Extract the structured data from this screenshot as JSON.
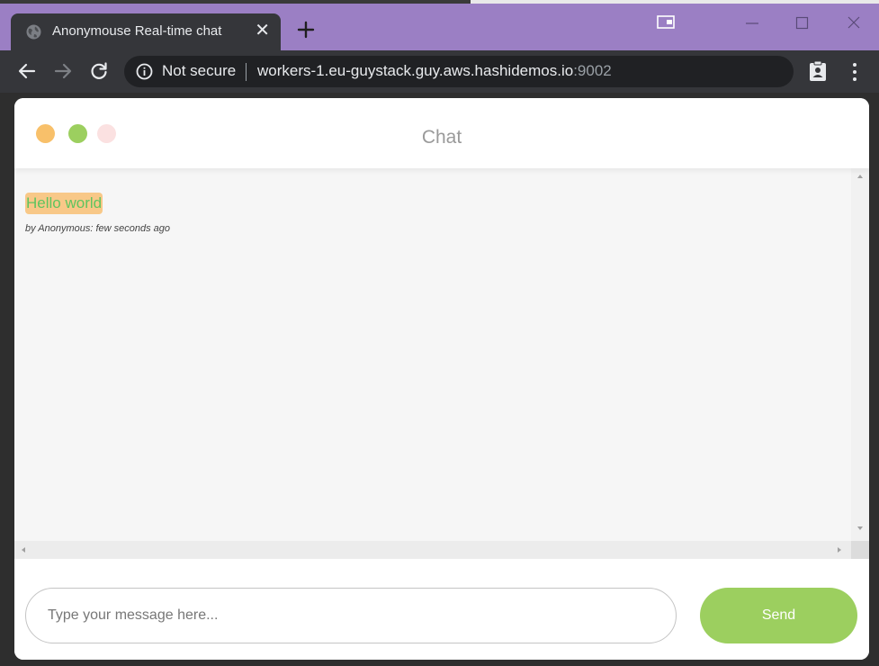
{
  "browser": {
    "tab_title": "Anonymouse Real-time chat",
    "omnibox": {
      "security_label": "Not secure",
      "url_host": "workers-1.eu-guystack.guy.aws.hashidemos.io",
      "url_port": ":9002"
    },
    "icons": {
      "favicon": "globe-icon",
      "tab_close": "close-icon",
      "new_tab": "plus-icon",
      "back": "arrow-left-icon",
      "forward": "arrow-right-icon",
      "reload": "reload-icon",
      "info": "info-icon",
      "extension": "clipboard-user-icon",
      "menu": "kebab-menu-icon",
      "window_switch": "window-icon",
      "minimize": "minimize-icon",
      "maximize": "maximize-icon",
      "window_close": "close-icon"
    },
    "colors": {
      "titlebar": "#9b7fc4",
      "tab": "#35363a",
      "omnibox": "#202124"
    }
  },
  "chat": {
    "title": "Chat",
    "header_dots": [
      {
        "name": "orange-dot",
        "color": "#f8c06a"
      },
      {
        "name": "green-dot",
        "color": "#9ccf5f"
      },
      {
        "name": "pink-dot",
        "color": "#fbe1e1"
      }
    ],
    "messages": [
      {
        "text": "Hello world",
        "meta": "by Anonymous: few seconds ago"
      }
    ],
    "input": {
      "placeholder": "Type your message here...",
      "value": ""
    },
    "send_label": "Send",
    "colors": {
      "bubble_bg": "#f8c888",
      "bubble_text": "#5fc45f",
      "send_button": "#9ccf5f"
    }
  }
}
